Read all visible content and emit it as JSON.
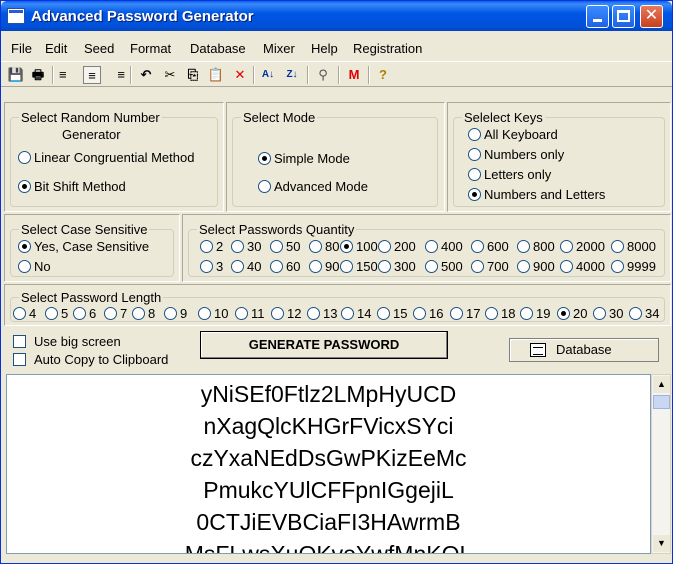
{
  "window": {
    "title": "Advanced Password Generator"
  },
  "menu": [
    "File",
    "Edit",
    "Seed",
    "Format",
    "Database",
    "Mixer",
    "Help",
    "Registration"
  ],
  "toolbar": {
    "icons": [
      "save-icon",
      "print-icon",
      "align-left-icon",
      "align-center-icon",
      "align-right-icon",
      "undo-icon",
      "cut-icon",
      "copy-icon",
      "paste-icon",
      "delete-icon",
      "sort-ascending-icon",
      "sort-descending-icon",
      "find-icon",
      "mixer-icon",
      "help-icon"
    ],
    "glyphs": [
      "💾",
      "🖶",
      "≡",
      "≡",
      "≡",
      "↶",
      "✂",
      "⎘",
      "📋",
      "✕",
      "A↓",
      "Z↓",
      "⚲",
      "M",
      "?"
    ]
  },
  "rng": {
    "legend_line1": "Select Random Number",
    "legend_line2": "Generator",
    "options": [
      "Linear Congruential Method",
      "Bit Shift Method"
    ],
    "selected": 1
  },
  "mode": {
    "legend": "Select Mode",
    "options": [
      "Simple Mode",
      "Advanced Mode"
    ],
    "selected": 0
  },
  "keys": {
    "legend": "Selelect Keys",
    "options": [
      "All Keyboard",
      "Numbers only",
      "Letters only",
      "Numbers and Letters"
    ],
    "selected": 3
  },
  "case": {
    "legend": "Select Case Sensitive",
    "options": [
      "Yes, Case Sensitive",
      "No"
    ],
    "selected": 0
  },
  "quantity": {
    "legend": "Select Passwords  Quantity",
    "row1": [
      "2",
      "30",
      "50",
      "80",
      "100",
      "200",
      "400",
      "600",
      "800",
      "2000",
      "8000"
    ],
    "row2": [
      "3",
      "40",
      "60",
      "90",
      "150",
      "300",
      "500",
      "700",
      "900",
      "4000",
      "9999"
    ],
    "selected": "100"
  },
  "length": {
    "legend": "Select Password Length",
    "options": [
      "4",
      "5",
      "6",
      "7",
      "8",
      "9",
      "10",
      "11",
      "12",
      "13",
      "14",
      "15",
      "16",
      "17",
      "18",
      "19",
      "20",
      "30",
      "34"
    ],
    "selected": "20"
  },
  "options": {
    "big_screen": "Use big screen",
    "auto_copy": "Auto Copy to Clipboard"
  },
  "buttons": {
    "generate": "GENERATE PASSWORD",
    "database": "Database"
  },
  "passwords": [
    "yNiSEf0Ftlz2LMpHyUCD",
    "nXagQlcKHGrFVicxSYci",
    "czYxaNEdDsGwPKizEeMc",
    "PmukcYUlCFFpnIGgejiL",
    "0CTJiEVBCiaFI3HAwrmB",
    "MsFLwsXuOKvoYwfMnKOL"
  ]
}
